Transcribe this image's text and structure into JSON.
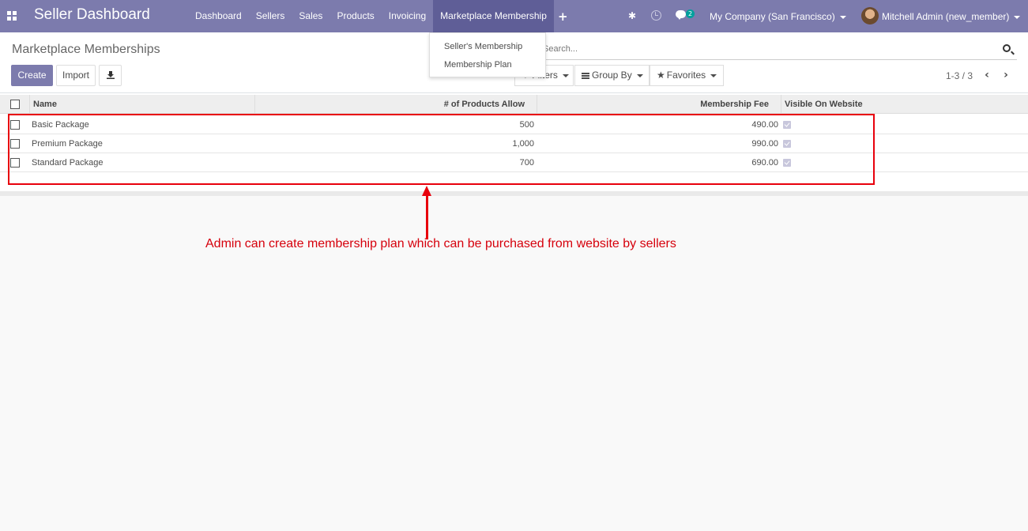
{
  "navbar": {
    "brand": "Seller Dashboard",
    "menu": [
      "Dashboard",
      "Sellers",
      "Sales",
      "Products",
      "Invoicing",
      "Marketplace Membership"
    ],
    "chat_count": "2",
    "company": "My Company (San Francisco)",
    "user": "Mitchell Admin (new_member)"
  },
  "dropdown": {
    "items": [
      "Seller's Membership",
      "Membership Plan"
    ]
  },
  "control_panel": {
    "title": "Marketplace Memberships",
    "create_label": "Create",
    "import_label": "Import",
    "search_placeholder": "Search...",
    "filters_label": "Filters",
    "groupby_label": "Group By",
    "favorites_label": "Favorites",
    "pager": "1-3 / 3"
  },
  "table": {
    "columns": [
      "Name",
      "# of Products Allow",
      "Membership Fee",
      "Visible On Website"
    ],
    "rows": [
      {
        "name": "Basic Package",
        "products": "500",
        "fee": "490.00",
        "visible": true
      },
      {
        "name": "Premium Package",
        "products": "1,000",
        "fee": "990.00",
        "visible": true
      },
      {
        "name": "Standard Package",
        "products": "700",
        "fee": "690.00",
        "visible": true
      }
    ]
  },
  "annotation": {
    "text": "Admin can create membership plan which can be purchased from website by sellers",
    "color": "#e8000c"
  },
  "colors": {
    "navbar": "#7c7bad",
    "primary_button": "#7c7bad",
    "annotation_red": "#e8000c"
  }
}
